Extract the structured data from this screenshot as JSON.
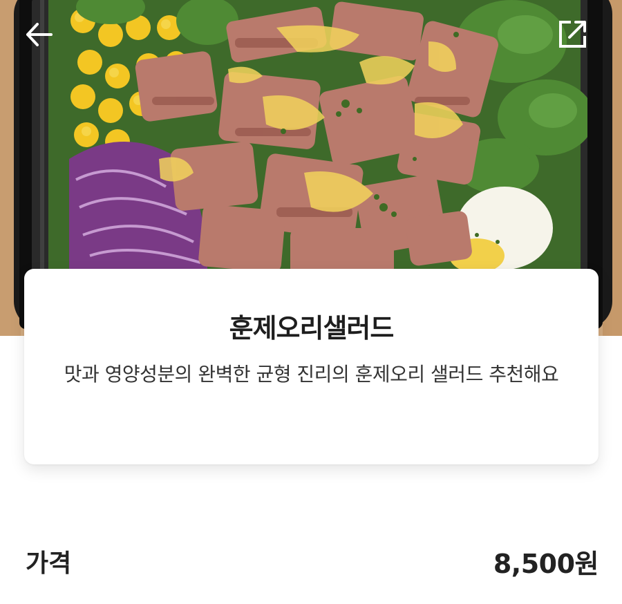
{
  "menu": {
    "title": "훈제오리샐러드",
    "description": "맛과 영양성분의 완벽한 균형 진리의 훈제오리 샐러드 추천해요"
  },
  "price": {
    "label": "가격",
    "value": "8,500원"
  },
  "icons": {
    "back": "back-arrow-icon",
    "share": "share-external-icon"
  },
  "colors": {
    "text_primary": "#1e1e1e",
    "card_background": "#ffffff"
  }
}
